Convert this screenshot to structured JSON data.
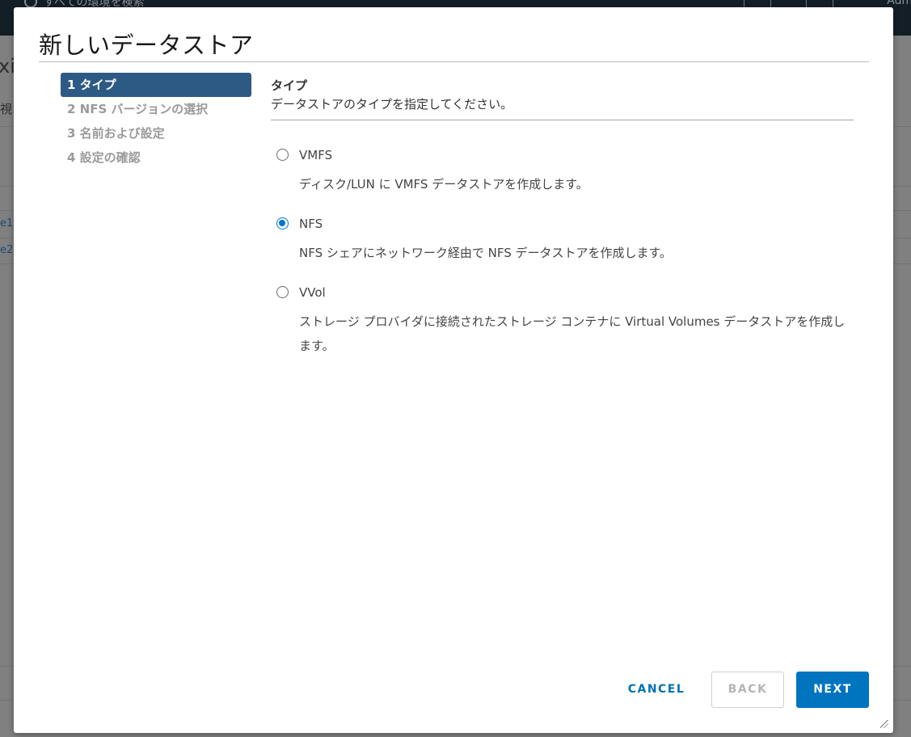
{
  "background": {
    "search_placeholder": "すべての環境を検索",
    "user_label": "Admi",
    "partial_title": "xi",
    "partial_tab": "視",
    "partial_rows": [
      "e1",
      "e2"
    ]
  },
  "dialog": {
    "title": "新しいデータストア",
    "steps": [
      {
        "label": "1 タイプ",
        "active": true
      },
      {
        "label": "2 NFS バージョンの選択",
        "active": false
      },
      {
        "label": "3 名前および設定",
        "active": false
      },
      {
        "label": "4 設定の確認",
        "active": false
      }
    ],
    "pane": {
      "heading": "タイプ",
      "subtitle": "データストアのタイプを指定してください。",
      "options": [
        {
          "label": "VMFS",
          "description": "ディスク/LUN に VMFS データストアを作成します。",
          "selected": false
        },
        {
          "label": "NFS",
          "description": "NFS シェアにネットワーク経由で NFS データストアを作成します。",
          "selected": true
        },
        {
          "label": "VVol",
          "description": "ストレージ プロバイダに接続されたストレージ コンテナに Virtual Volumes データストアを作成します。",
          "selected": false
        }
      ]
    },
    "buttons": {
      "cancel": "CANCEL",
      "back": "BACK",
      "next": "NEXT"
    }
  },
  "colors": {
    "active_step": "#2d5a85",
    "primary_button": "#0074bf",
    "radio_selected": "#0072d6",
    "link": "#0073b3"
  }
}
